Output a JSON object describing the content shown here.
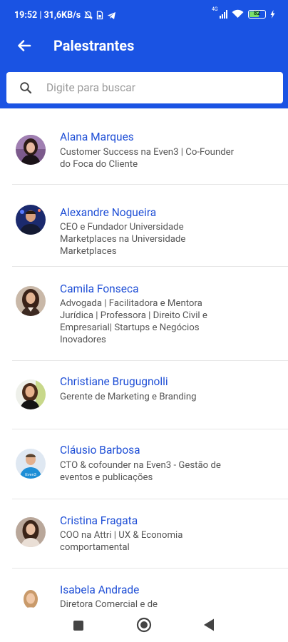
{
  "status_bar": {
    "time_speed": "19:52 | 31,6KB/s",
    "network_type": "4G",
    "battery_level": "82"
  },
  "header": {
    "title": "Palestrantes"
  },
  "search": {
    "placeholder": "Digite para buscar"
  },
  "speakers": [
    {
      "name": "Alana Marques",
      "role": "Customer Success na Even3 | Co-Founder do Foca do Cliente"
    },
    {
      "name": "Alexandre Nogueira",
      "role": "CEO e Fundador Universidade Marketplaces na Universidade Marketplaces"
    },
    {
      "name": "Camila Fonseca",
      "role": "Advogada | Facilitadora e Mentora Jurídica | Professora | Direito Civil e Empresarial| Startups e Negócios Inovadores"
    },
    {
      "name": "Christiane Brugugnolli",
      "role": "Gerente de Marketing e Branding"
    },
    {
      "name": "Cláusio Barbosa",
      "role": "CTO & cofounder na Even3 - Gestão de eventos e publicações"
    },
    {
      "name": "Cristina Fragata",
      "role": "COO na Attri | UX & Economia comportamental"
    },
    {
      "name": "Isabela Andrade",
      "role": "Diretora Comercial e de"
    }
  ],
  "avatar_shirt_text": "Even3",
  "colors": {
    "primary": "#1a53e3",
    "speaker_name": "#1f4fd6",
    "role_text": "#555555",
    "divider": "#e6e6e6"
  },
  "icons": {
    "back": "arrow-left-icon",
    "search": "search-icon",
    "nav_recents": "square-icon",
    "nav_home": "circle-icon",
    "nav_back": "triangle-back-icon"
  }
}
